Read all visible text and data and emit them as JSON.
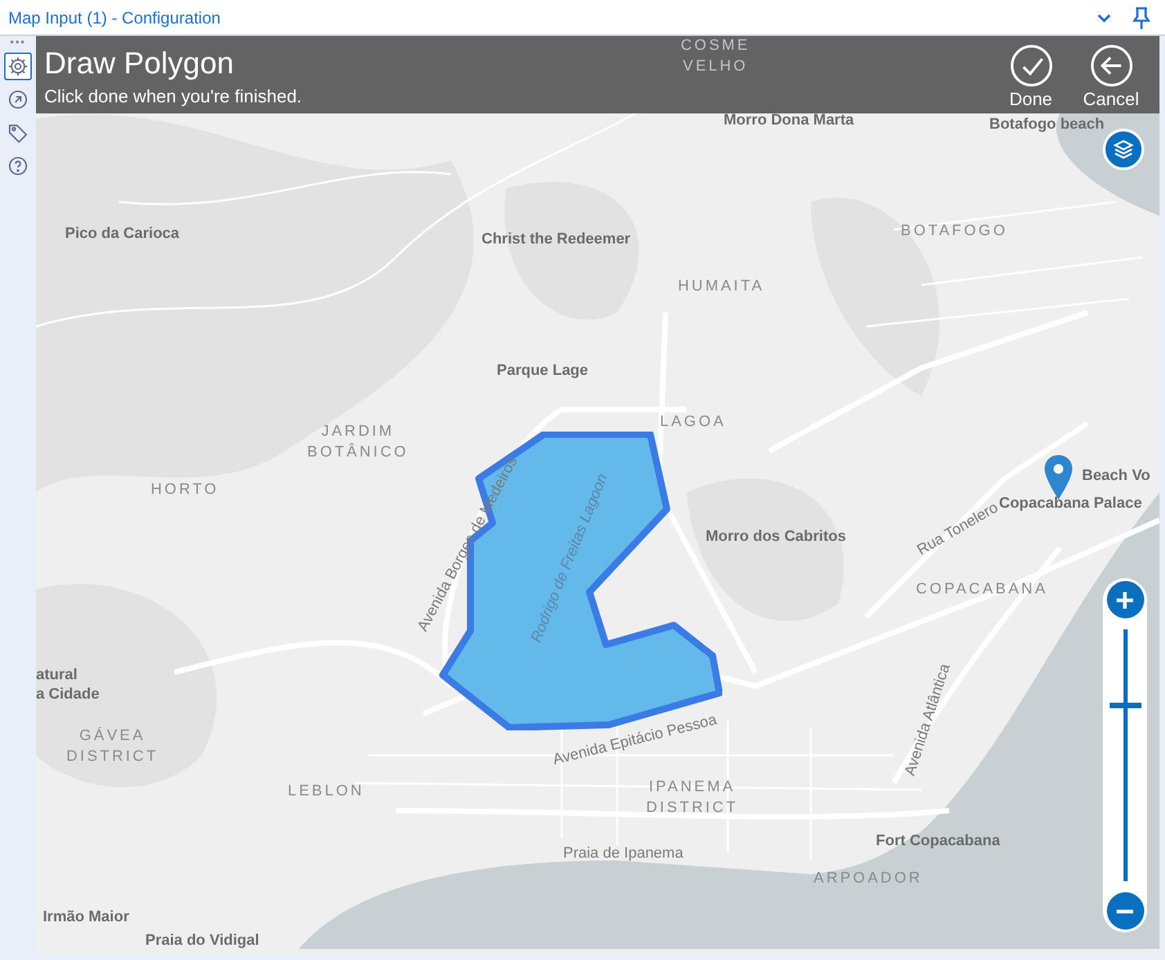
{
  "window": {
    "title": "Map Input (1) - Configuration"
  },
  "sidebar": {
    "more": "•••",
    "tabs": [
      {
        "selected": true
      },
      {
        "selected": false
      },
      {
        "selected": false
      },
      {
        "selected": false
      }
    ]
  },
  "header": {
    "title": "Draw Polygon",
    "subtitle": "Click done when you're finished."
  },
  "buttons": [
    {
      "label": "Done"
    },
    {
      "label": "Cancel"
    }
  ],
  "map": {
    "labels": [
      {
        "text": "COSME VELHO",
        "kind": "shaded_district"
      },
      {
        "text": "Morro Dona Marta",
        "kind": "place"
      },
      {
        "text": "Botafogo beach",
        "kind": "place"
      },
      {
        "text": "Pico da Carioca",
        "kind": "place"
      },
      {
        "text": "Christ the Redeemer",
        "kind": "place"
      },
      {
        "text": "BOTAFOGO",
        "kind": "district"
      },
      {
        "text": "HUMAITA",
        "kind": "district"
      },
      {
        "text": "Parque Lage",
        "kind": "place"
      },
      {
        "text": "JARDIM BOTÂNICO",
        "kind": "district"
      },
      {
        "text": "LAGOA",
        "kind": "district"
      },
      {
        "text": "HORTO",
        "kind": "district"
      },
      {
        "text": "Avenida Borges de Medeiros",
        "kind": "road"
      },
      {
        "text": "Rodrigo de Freitas Lagoon",
        "kind": "water"
      },
      {
        "text": "Morro dos Cabritos",
        "kind": "place"
      },
      {
        "text": "Rua Tonelero",
        "kind": "road"
      },
      {
        "text": "Beach Vo",
        "kind": "place"
      },
      {
        "text": "Copacabana Palace",
        "kind": "place"
      },
      {
        "text": "COPACABANA",
        "kind": "district"
      },
      {
        "text": "atural",
        "kind": "place"
      },
      {
        "text": "a Cidade",
        "kind": "place"
      },
      {
        "text": "GÁVEA DISTRICT",
        "kind": "district"
      },
      {
        "text": "Avenida Epitácio Pessoa",
        "kind": "road"
      },
      {
        "text": "Avenida Atlântica",
        "kind": "road"
      },
      {
        "text": "LEBLON",
        "kind": "district"
      },
      {
        "text": "IPANEMA DISTRICT",
        "kind": "district"
      },
      {
        "text": "Fort Copacabana",
        "kind": "place"
      },
      {
        "text": "Praia de Ipanema",
        "kind": "road"
      },
      {
        "text": "ARPOADOR",
        "kind": "district"
      },
      {
        "text": "Irmão Maior",
        "kind": "place"
      },
      {
        "text": "Praia do Vidigal",
        "kind": "place"
      }
    ]
  },
  "zoom": {
    "level": 0.7
  }
}
